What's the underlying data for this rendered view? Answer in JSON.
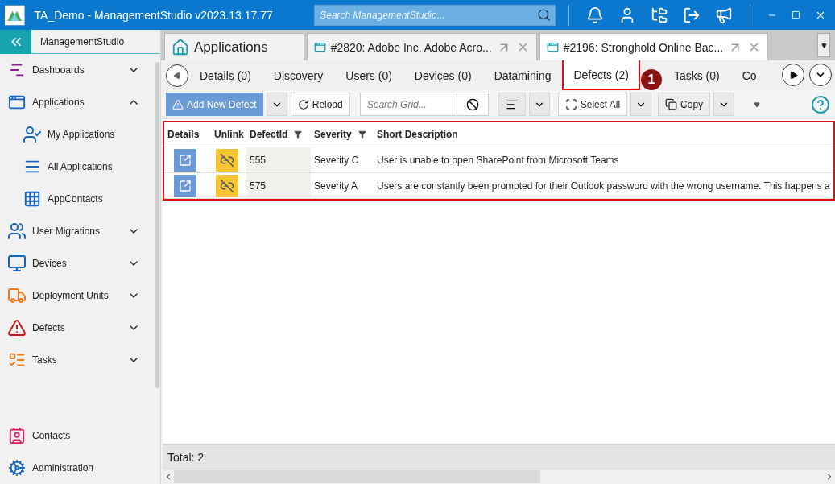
{
  "window": {
    "title": "TA_Demo - ManagementStudio v2023.13.17.77"
  },
  "search": {
    "placeholder": "Search ManagementStudio..."
  },
  "sidebar": {
    "title": "ManagementStudio",
    "items": [
      {
        "label": "Dashboards",
        "expanded": false
      },
      {
        "label": "Applications",
        "expanded": true,
        "children": [
          {
            "label": "My Applications"
          },
          {
            "label": "All Applications"
          },
          {
            "label": "AppContacts"
          }
        ]
      },
      {
        "label": "User Migrations",
        "expanded": false
      },
      {
        "label": "Devices",
        "expanded": false
      },
      {
        "label": "Deployment Units",
        "expanded": false
      },
      {
        "label": "Defects",
        "expanded": false
      },
      {
        "label": "Tasks",
        "expanded": false
      }
    ],
    "bottom_items": [
      {
        "label": "Contacts"
      },
      {
        "label": "Administration"
      }
    ]
  },
  "doc_tabs": [
    {
      "kind": "home",
      "label": "Applications",
      "selected": false
    },
    {
      "kind": "record",
      "label": "#2820: Adobe Inc. Adobe Acro...",
      "selected": false
    },
    {
      "kind": "record",
      "label": "#2196: Stronghold Online Bac...",
      "selected": true
    }
  ],
  "subtabs": [
    {
      "label": "Details (0)",
      "selected": false,
      "highlighted": false
    },
    {
      "label": "Discovery",
      "selected": false,
      "highlighted": false
    },
    {
      "label": "Users (0)",
      "selected": false,
      "highlighted": false
    },
    {
      "label": "Devices (0)",
      "selected": false,
      "highlighted": false
    },
    {
      "label": "Datamining",
      "selected": false,
      "highlighted": false
    },
    {
      "label": "Defects (2)",
      "selected": true,
      "highlighted": true
    },
    {
      "label": "Tasks (0)",
      "selected": false,
      "highlighted": false
    },
    {
      "label": "Co",
      "selected": false,
      "highlighted": false
    }
  ],
  "toolbar": {
    "add_button": "Add New Defect",
    "reload_button": "Reload",
    "grid_search": {
      "placeholder": "Search Grid..."
    },
    "select_all_button": "Select All",
    "copy_button": "Copy"
  },
  "callout": {
    "label": "1"
  },
  "grid": {
    "highlighted": true,
    "columns": [
      {
        "label": "Details",
        "filter": false
      },
      {
        "label": "Unlink",
        "filter": false
      },
      {
        "label": "DefectId",
        "filter": true
      },
      {
        "label": "Severity",
        "filter": true
      },
      {
        "label": "Short Description",
        "filter": false
      }
    ],
    "rows": [
      {
        "defect_id": "555",
        "severity": "Severity C",
        "description": "User is unable to open SharePoint from Microsoft Teams"
      },
      {
        "defect_id": "575",
        "severity": "Severity A",
        "description": "Users are constantly been prompted for their Outlook password with the wrong username. This happens a"
      }
    ]
  },
  "footer": {
    "total": "Total: 2"
  }
}
